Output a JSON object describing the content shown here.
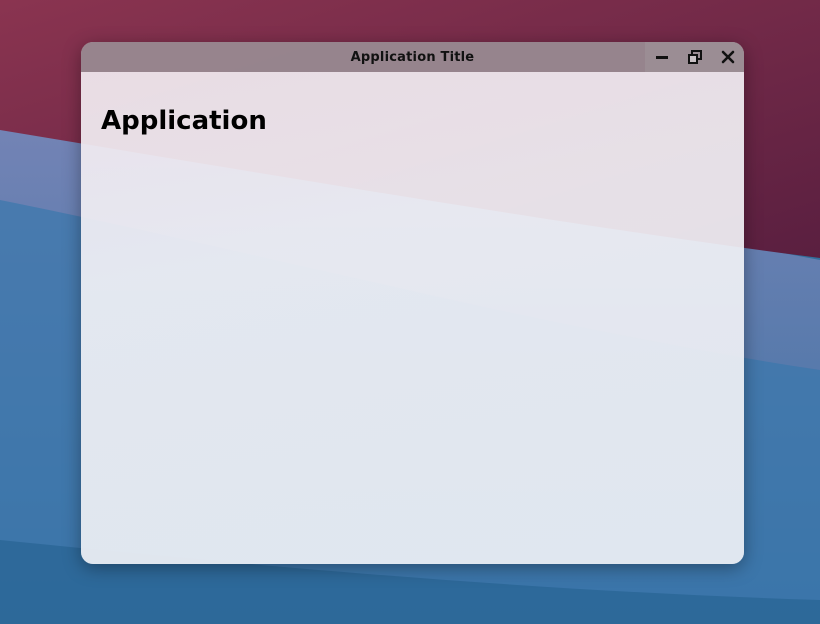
{
  "window": {
    "title": "Application Title",
    "controls": {
      "minimize_icon": "minimize-icon",
      "restore_icon": "restore-icon",
      "close_icon": "close-icon"
    }
  },
  "content": {
    "heading": "Application"
  },
  "colors": {
    "titlebar": "#7a646e",
    "window_body": "#f2eff4",
    "wallpaper_top": "#6b2a4a",
    "wallpaper_bottom": "#25608f"
  }
}
